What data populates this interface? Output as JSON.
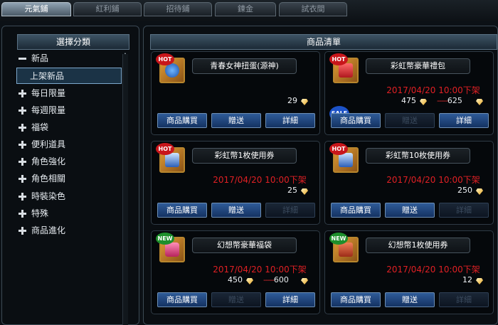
{
  "top_tabs": [
    {
      "label": "元氣鋪",
      "active": true
    },
    {
      "label": "紅利鋪",
      "active": false
    },
    {
      "label": "招待鋪",
      "active": false
    },
    {
      "label": "鍊金",
      "active": false
    },
    {
      "label": "試衣間",
      "active": false
    }
  ],
  "categories_panel": {
    "title": "選擇分類",
    "items": [
      {
        "label": "新品",
        "sign": "minus"
      },
      {
        "label": "上架新品",
        "selected": true
      },
      {
        "label": "每日限量",
        "sign": "plus"
      },
      {
        "label": "每週限量",
        "sign": "plus"
      },
      {
        "label": "福袋",
        "sign": "plus"
      },
      {
        "label": "便利道具",
        "sign": "plus"
      },
      {
        "label": "角色強化",
        "sign": "plus"
      },
      {
        "label": "角色相關",
        "sign": "plus"
      },
      {
        "label": "時裝染色",
        "sign": "plus"
      },
      {
        "label": "特殊",
        "sign": "plus"
      },
      {
        "label": "商品進化",
        "sign": "plus"
      }
    ]
  },
  "products_panel": {
    "title": "商品清單",
    "buttons": {
      "buy": "商品購買",
      "gift": "贈送",
      "detail": "詳細"
    },
    "products": [
      {
        "name": "青春女神扭蛋(源神)",
        "badge": "HOT",
        "sale": false,
        "deadline": "",
        "price": "29",
        "original_price": "",
        "gift_enabled": true,
        "detail_enabled": true
      },
      {
        "name": "彩虹幣豪華禮包",
        "badge": "HOT",
        "sale": true,
        "sale_label": "SALE",
        "deadline": "2017/04/20 10:00下架",
        "price": "475",
        "original_price": "625",
        "gift_enabled": false,
        "detail_enabled": true
      },
      {
        "name": "彩虹幣1枚使用券",
        "badge": "HOT",
        "sale": false,
        "deadline": "2017/04/20 10:00下架",
        "price": "25",
        "original_price": "",
        "gift_enabled": true,
        "detail_enabled": false
      },
      {
        "name": "彩虹幣10枚使用券",
        "badge": "HOT",
        "sale": false,
        "deadline": "2017/04/20 10:00下架",
        "price": "250",
        "original_price": "",
        "gift_enabled": true,
        "detail_enabled": false
      },
      {
        "name": "幻想幣豪華福袋",
        "badge": "NEW",
        "sale": false,
        "deadline": "2017/04/20 10:00下架",
        "price": "450",
        "original_price": "600",
        "gift_enabled": false,
        "detail_enabled": true
      },
      {
        "name": "幻想幣1枚使用券",
        "badge": "NEW",
        "sale": false,
        "deadline": "2017/04/20 10:00下架",
        "price": "12",
        "original_price": "",
        "gift_enabled": true,
        "detail_enabled": false
      }
    ]
  },
  "colors": {
    "deadline": "#e02024",
    "button": "#2f5b98",
    "hot_badge": "#c8161b",
    "new_badge": "#1e8f2c",
    "sale_badge": "#1c52c8"
  },
  "icons": {
    "currency": "gem-icon",
    "expanded": "minus-icon",
    "collapsed": "plus-icon"
  }
}
